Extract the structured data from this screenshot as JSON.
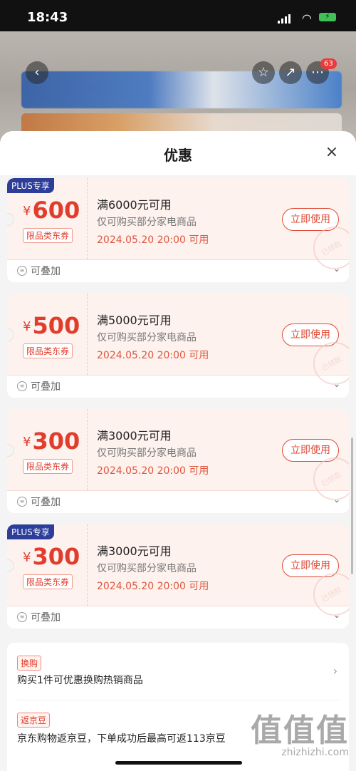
{
  "status": {
    "time": "18:43"
  },
  "background": {
    "cart_badge": "63"
  },
  "sheet": {
    "title": "优惠"
  },
  "coupons": [
    {
      "plus": "PLUS专享",
      "currency": "¥",
      "amount": "600",
      "type": "限品类东券",
      "condition": "满6000元可用",
      "scope": "仅可购买部分家电商品",
      "validity": "2024.05.20 20:00 可用",
      "button": "立即使用",
      "stamp": "已领取",
      "stack": "可叠加"
    },
    {
      "plus": "",
      "currency": "¥",
      "amount": "500",
      "type": "限品类东券",
      "condition": "满5000元可用",
      "scope": "仅可购买部分家电商品",
      "validity": "2024.05.20 20:00 可用",
      "button": "立即使用",
      "stamp": "已领取",
      "stack": "可叠加"
    },
    {
      "plus": "",
      "currency": "¥",
      "amount": "300",
      "type": "限品类东券",
      "condition": "满3000元可用",
      "scope": "仅可购买部分家电商品",
      "validity": "2024.05.20 20:00 可用",
      "button": "立即使用",
      "stamp": "已领取",
      "stack": "可叠加"
    },
    {
      "plus": "PLUS专享",
      "currency": "¥",
      "amount": "300",
      "type": "限品类东券",
      "condition": "满3000元可用",
      "scope": "仅可购买部分家电商品",
      "validity": "2024.05.20 20:00 可用",
      "button": "立即使用",
      "stamp": "已领取",
      "stack": "可叠加"
    }
  ],
  "promos": [
    {
      "tag": "换购",
      "text": "购买1件可优惠换购热销商品"
    },
    {
      "tag": "返京豆",
      "text": "京东购物返京豆，下单成功后最高可返113京豆"
    }
  ],
  "watermark": {
    "logo": "值值值",
    "site": "zhizhizhi.com"
  }
}
